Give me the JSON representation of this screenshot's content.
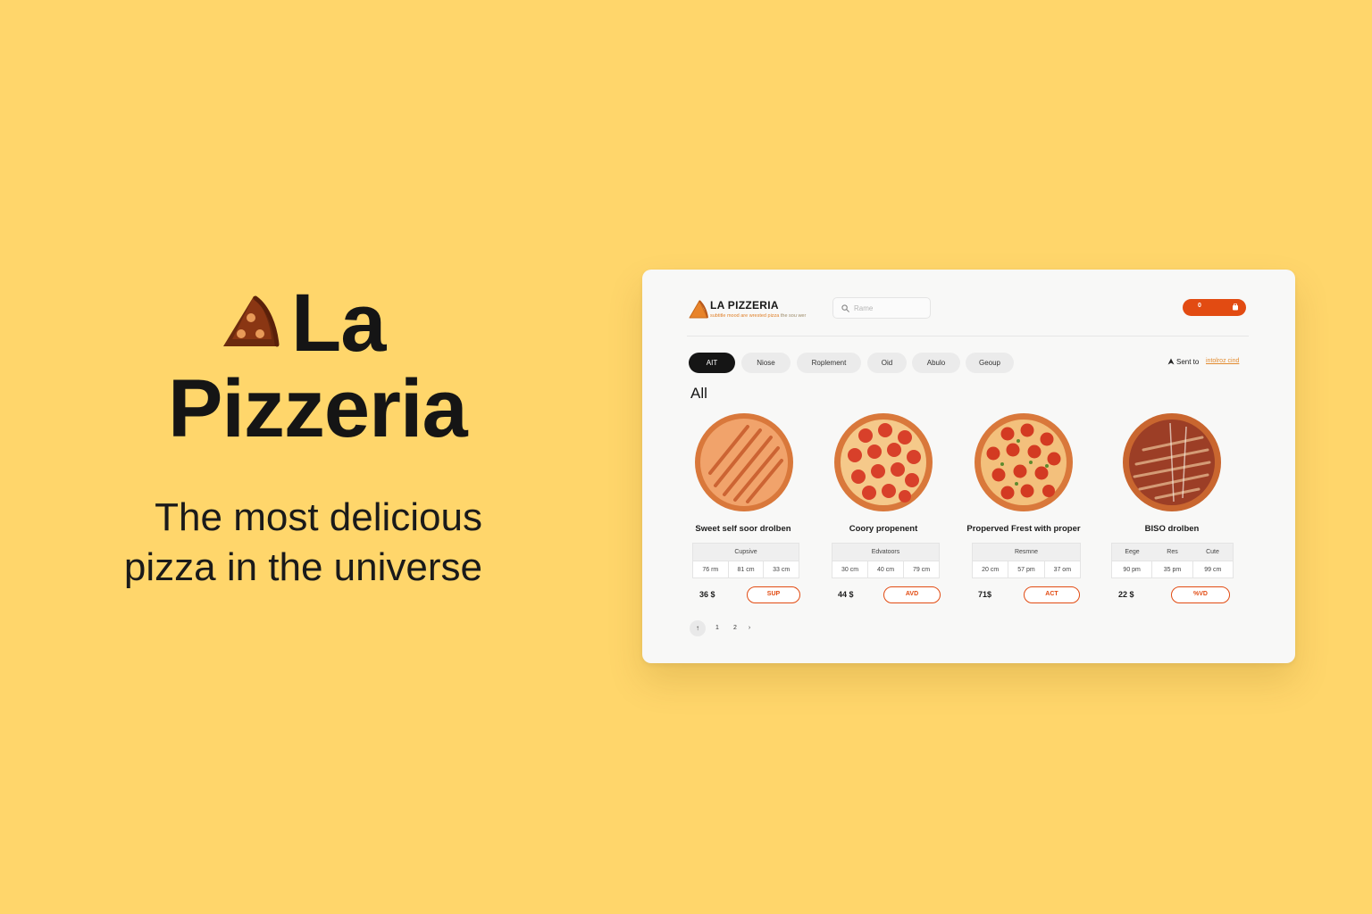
{
  "hero": {
    "title_line1": "La",
    "title_line2": "Pizzeria",
    "tagline": "The most delicious pizza in the universe",
    "logo_icon": "pizza-slice-icon",
    "logo_color": "#6B2A0E"
  },
  "app": {
    "brand": "LA PIZZERIA",
    "brand_sub_highlight": "subtitle mood are wrested pizza",
    "brand_sub_rest": " the sou wer",
    "search": {
      "placeholder": "Rame",
      "value": "",
      "icon": "search-icon"
    },
    "cart": {
      "count": "0",
      "icon": "cart-icon",
      "color": "#E24B12"
    },
    "categories": [
      {
        "label": "AIT",
        "active": true
      },
      {
        "label": "Niose",
        "active": false
      },
      {
        "label": "Roplement",
        "active": false
      },
      {
        "label": "Oid",
        "active": false
      },
      {
        "label": "Abulo",
        "active": false
      },
      {
        "label": "Geoup",
        "active": false
      }
    ],
    "sort": {
      "label": "Sent to",
      "value": "intolroz  cind",
      "icon": "sort-icon"
    },
    "section_title": "All",
    "products": [
      {
        "name": "Sweet self soor drolben",
        "size_headers": [
          "Cupsive"
        ],
        "sizes": [
          "76 rm",
          "81 cm",
          "33 cm"
        ],
        "price": "36 $",
        "button": "SUP",
        "pizza_style": "striped-cheese"
      },
      {
        "name": "Coory propenent",
        "size_headers": [
          "Edvatoors"
        ],
        "sizes": [
          "30 cm",
          "40 cm",
          "79 cm"
        ],
        "price": "44 $",
        "button": "AVD",
        "pizza_style": "pepperoni"
      },
      {
        "name": "Properved Frest with proper",
        "size_headers": [
          "Resmne"
        ],
        "sizes": [
          "20 cm",
          "57 pm",
          "37 om"
        ],
        "price": "71$",
        "button": "ACT",
        "pizza_style": "pepperoni"
      },
      {
        "name": "BISO drolben",
        "size_headers": [
          "Eege",
          "Res",
          "Cute"
        ],
        "sizes": [
          "90 pm",
          "35 pm",
          "99 cm"
        ],
        "price": "22 $",
        "button": "%VD",
        "pizza_style": "bbq-striped"
      }
    ],
    "pagination": {
      "prev": "↑",
      "pages": [
        "1",
        "2"
      ],
      "next": "›"
    }
  },
  "colors": {
    "background": "#FFD66B",
    "accent": "#E24B12",
    "chip_active": "#151515",
    "card": "#F8F8F7"
  }
}
